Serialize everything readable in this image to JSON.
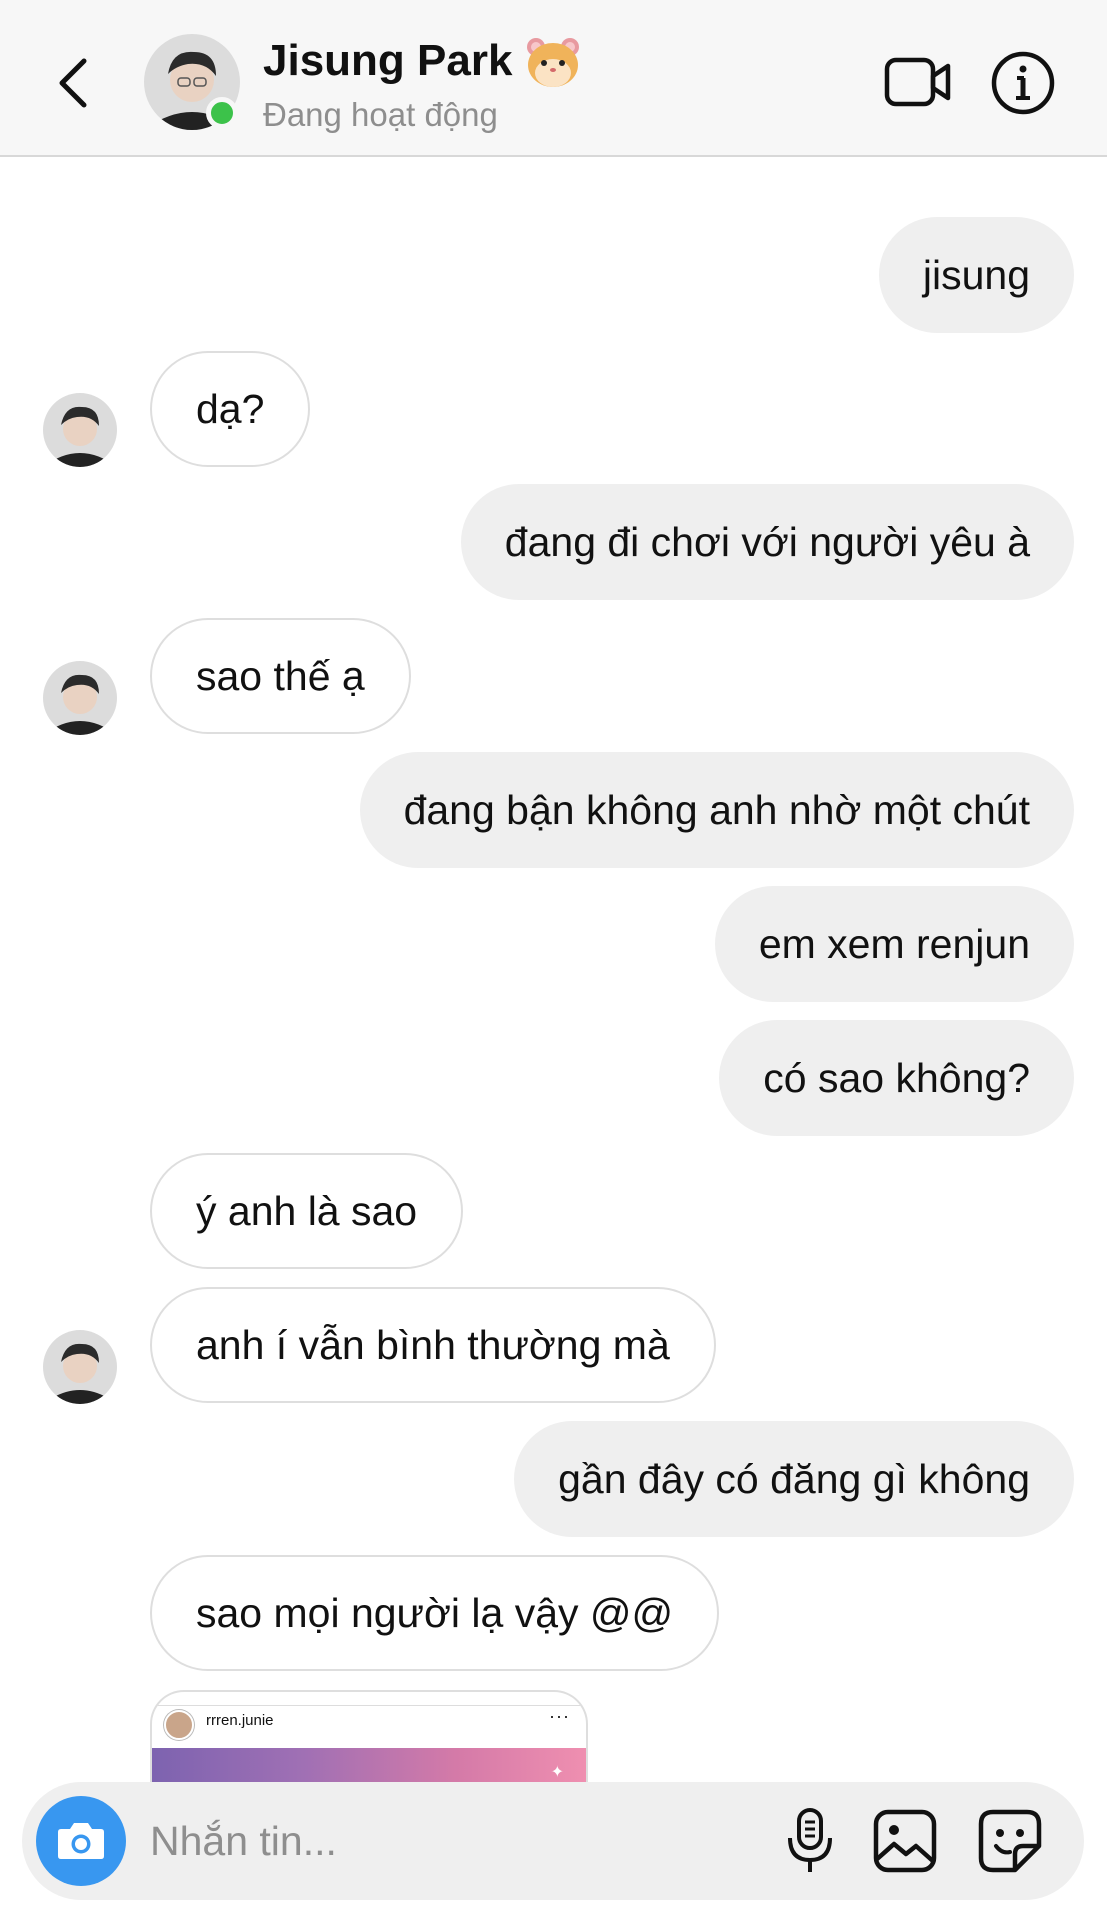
{
  "header": {
    "name": "Jisung Park",
    "emoji": "hamster-emoji",
    "status": "Đang hoạt động",
    "online_color": "#3cc24a"
  },
  "messages": [
    {
      "side": "out",
      "text": "jisung"
    },
    {
      "side": "in",
      "text": "dạ?",
      "avatar": true
    },
    {
      "side": "out",
      "text": "đang đi chơi với người yêu à"
    },
    {
      "side": "in",
      "text": "sao thế ạ",
      "avatar": true
    },
    {
      "side": "out",
      "text": "đang bận không anh nhờ một chút"
    },
    {
      "side": "out",
      "text": "em xem renjun"
    },
    {
      "side": "out",
      "text": "có sao không?"
    },
    {
      "side": "in",
      "text": "ý anh là sao",
      "avatar": false
    },
    {
      "side": "in",
      "text": "anh í vẫn bình thường mà",
      "avatar": true
    },
    {
      "side": "out",
      "text": "gần đây có đăng gì không"
    },
    {
      "side": "in",
      "text": "sao mọi người lạ vậy @@",
      "avatar": false
    }
  ],
  "shared_post": {
    "username": "rrren.junie",
    "menu": "···"
  },
  "composer": {
    "placeholder": "Nhắn tin...",
    "camera_color": "#3897f0"
  },
  "colors": {
    "outgoing_bubble": "#efefef",
    "incoming_border": "#dedede",
    "header_bg": "#f7f7f7"
  }
}
